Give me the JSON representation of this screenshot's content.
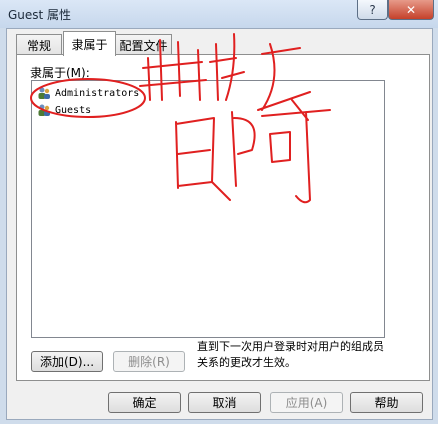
{
  "window": {
    "title": "Guest 属性",
    "help_label": "?",
    "close_label": "✕"
  },
  "tabs": [
    "常规",
    "隶属于",
    "配置文件"
  ],
  "group_label": "隶属于(M):",
  "members": [
    "Administrators",
    "Guests"
  ],
  "buttons": {
    "add": "添加(D)...",
    "remove": "删除(R)",
    "ok": "确定",
    "cancel": "取消",
    "apply": "应用(A)",
    "help": "帮助"
  },
  "note": "直到下一次用户登录时对用户的组成员关系的更改才生效。",
  "annotation_color": "#e02020",
  "icons": {
    "user": "user-group-icon"
  }
}
